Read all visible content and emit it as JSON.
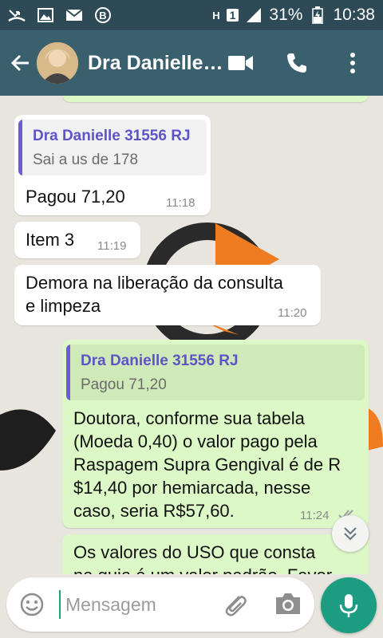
{
  "status_bar": {
    "battery": "31%",
    "time": "10:38",
    "sim_label": "1",
    "network": "H"
  },
  "header": {
    "title": "Dra Danielle…"
  },
  "messages": [
    {
      "direction": "in",
      "quote": {
        "author": "Dra Danielle 31556 RJ",
        "text": "Sai a us de 178"
      },
      "text": "Pagou 71,20",
      "time": "11:18"
    },
    {
      "direction": "in",
      "text": "Item 3",
      "time": "11:19"
    },
    {
      "direction": "in",
      "lines": [
        "Demora na liberação da consulta",
        "e limpeza"
      ],
      "time": "11:20"
    },
    {
      "direction": "out",
      "quote": {
        "author": "Dra Danielle 31556 RJ",
        "text": "Pagou 71,20"
      },
      "lines": [
        "Doutora, conforme sua tabela",
        "(Moeda 0,40) o valor pago pela",
        "Raspagem Supra Gengival é de R",
        "$14,40 por hemiarcada, nesse",
        "caso, seria R$57,60."
      ],
      "time": "11:24"
    },
    {
      "direction": "out",
      "lines": [
        "Os valores do USO que consta",
        "na guia é um valor padrão. Favor"
      ]
    }
  ],
  "input": {
    "placeholder": "Mensagem"
  },
  "colors": {
    "status_bar": "#2e4a56",
    "toolbar": "#3a5f6d",
    "incoming": "#ffffff",
    "outgoing": "#dcf8c6",
    "quote_name": "#5e54c7",
    "accent": "#1c9d82"
  },
  "icons": {
    "back": "arrow-left-icon",
    "video": "video-camera-icon",
    "call": "phone-icon",
    "menu": "more-vert-icon",
    "emoji": "emoji-icon",
    "attach": "paperclip-icon",
    "camera": "camera-icon",
    "mic": "microphone-icon",
    "scroll": "chevron-double-down-icon"
  }
}
